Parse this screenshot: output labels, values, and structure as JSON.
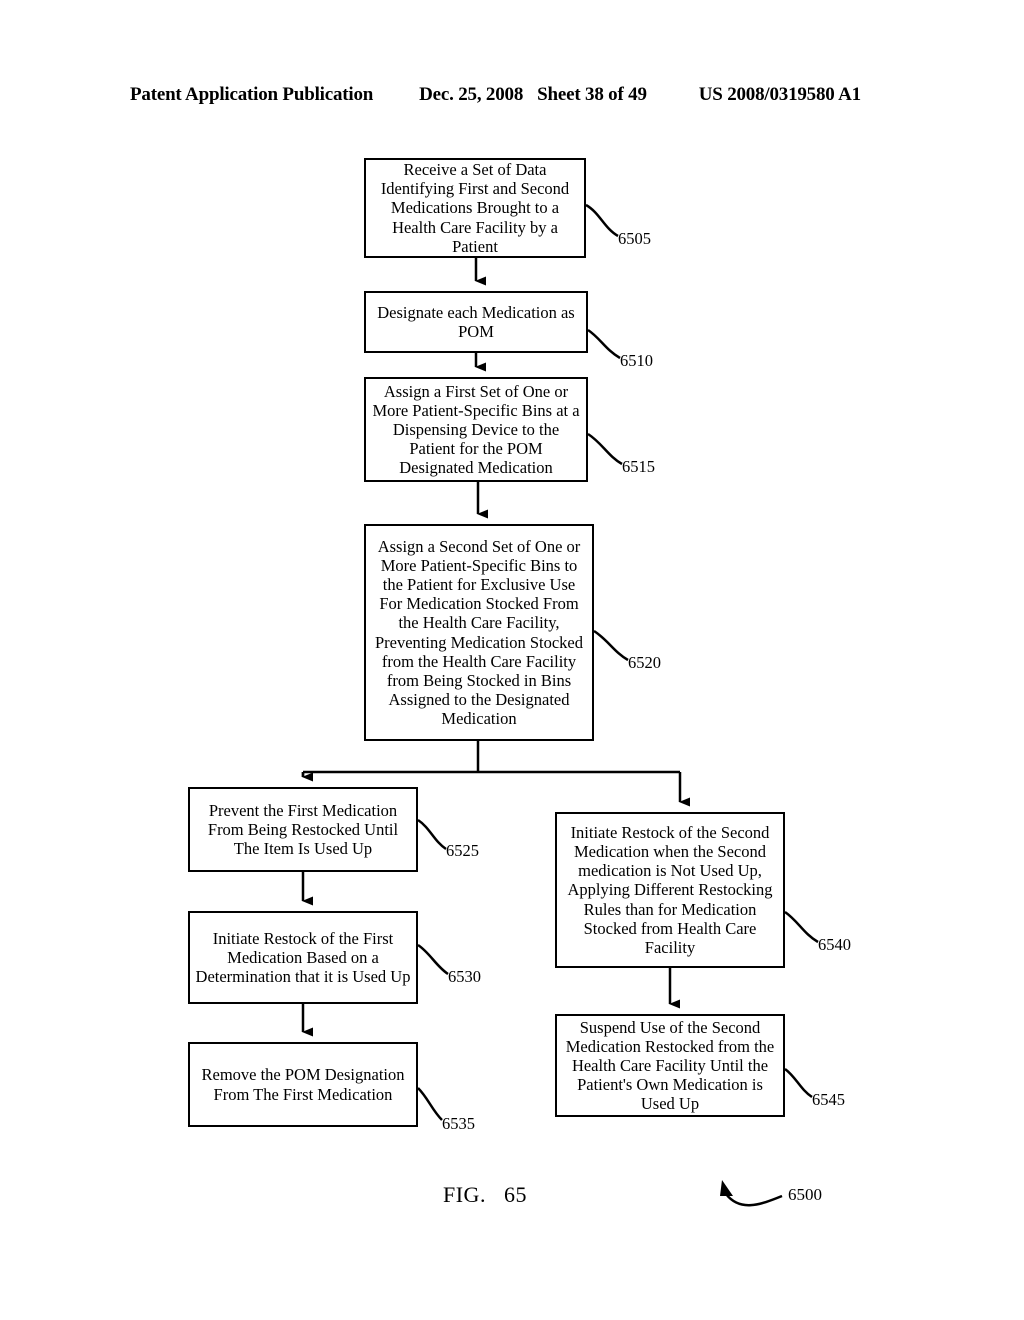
{
  "header": {
    "publication": "Patent Application Publication",
    "date": "Dec. 25, 2008",
    "sheet": "Sheet 38 of 49",
    "patent_number": "US 2008/0319580 A1"
  },
  "figure": {
    "caption_word": "FIG.",
    "caption_number": "65",
    "diagram_ref": "6500"
  },
  "boxes": {
    "b6505": {
      "text": "Receive a Set of Data Identifying First and Second Medications Brought to a Health Care Facility by a Patient",
      "ref": "6505"
    },
    "b6510": {
      "text": "Designate each Medication as POM",
      "ref": "6510"
    },
    "b6515": {
      "text": "Assign a First Set of One or More Patient-Specific Bins at a Dispensing Device to the Patient for the POM Designated Medication",
      "ref": "6515"
    },
    "b6520": {
      "text": "Assign a Second Set of One or More Patient-Specific Bins to the Patient for Exclusive Use For Medication Stocked From the Health Care Facility, Preventing Medication Stocked from the Health Care Facility from Being Stocked in Bins Assigned to the Designated Medication",
      "ref": "6520"
    },
    "b6525": {
      "text": "Prevent the First Medication From Being Restocked Until The Item Is Used Up",
      "ref": "6525"
    },
    "b6530": {
      "text": "Initiate Restock of the First Medication Based on a Determination that it is Used Up",
      "ref": "6530"
    },
    "b6535": {
      "text": "Remove the POM Designation From The First Medication",
      "ref": "6535"
    },
    "b6540": {
      "text": "Initiate Restock of the Second Medication when the Second medication is Not Used Up, Applying Different Restocking Rules than for Medication Stocked from Health Care Facility",
      "ref": "6540"
    },
    "b6545": {
      "text": "Suspend Use of the Second Medication Restocked from the Health Care Facility Until the Patient's Own Medication is Used Up",
      "ref": "6545"
    }
  },
  "colors": {
    "ink": "#000000",
    "paper": "#ffffff"
  }
}
